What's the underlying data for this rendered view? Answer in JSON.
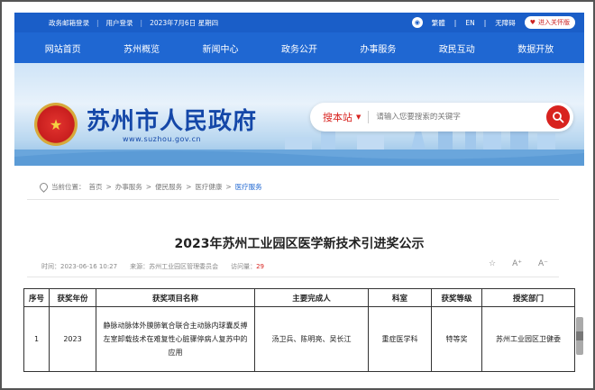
{
  "util": {
    "links": [
      "政务邮箱登录",
      "用户登录",
      "2023年7月6日 星期四"
    ],
    "lang_trad": "繁體",
    "lang_en": "EN",
    "accessible": "无障碍",
    "care": "进入关怀版"
  },
  "nav": [
    "网站首页",
    "苏州概览",
    "新闻中心",
    "政务公开",
    "办事服务",
    "政民互动",
    "数据开放"
  ],
  "banner": {
    "title": "苏州市人民政府",
    "url": "www.suzhou.gov.cn",
    "search_scope": "搜本站",
    "search_placeholder": "请输入您要搜索的关键字"
  },
  "breadcrumb": {
    "label": "当前位置：",
    "items": [
      "首页",
      "办事服务",
      "便民服务",
      "医疗健康"
    ],
    "current": "医疗服务"
  },
  "article": {
    "title": "2023年苏州工业园区医学新技术引进奖公示",
    "time_label": "时间：",
    "time": "2023-06-16 10:27",
    "source_label": "来源：",
    "source": "苏州工业园区管理委员会",
    "visits_label": "访问量：",
    "visits": "29",
    "font_up": "A⁺",
    "font_down": "A⁻"
  },
  "table": {
    "headers": [
      "序号",
      "获奖年份",
      "获奖项目名称",
      "主要完成人",
      "科室",
      "获奖等级",
      "授奖部门"
    ],
    "rows": [
      [
        "1",
        "2023",
        "静脉动脉体外膜肺氧合联合主动脉内球囊反搏左室卸载技术在难复性心脏骤停病人复苏中的应用",
        "汤卫兵、陈明亮、吴长江",
        "重症医学科",
        "特等奖",
        "苏州工业园区卫健委"
      ]
    ]
  },
  "colors": {
    "primary": "#1f67d2",
    "accent": "#d8231f"
  }
}
